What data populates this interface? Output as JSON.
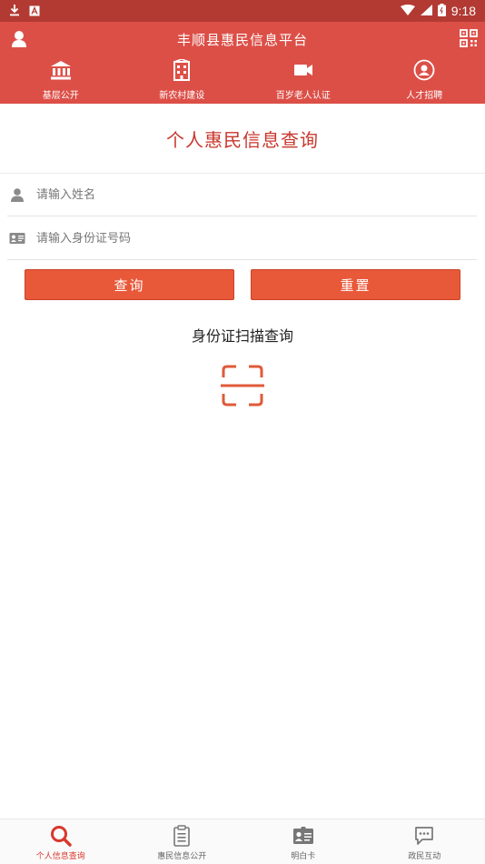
{
  "status_bar": {
    "left_icons": [
      "download-icon",
      "a-square-icon"
    ],
    "right_icons": [
      "wifi-icon",
      "signal-icon",
      "battery-icon"
    ],
    "time": "9:18"
  },
  "header": {
    "title": "丰顺县惠民信息平台",
    "left_icon": "user-icon",
    "right_icon": "qr-code-icon",
    "nav": [
      {
        "label": "基层公开",
        "icon": "bank-icon"
      },
      {
        "label": "新农村建设",
        "icon": "building-icon"
      },
      {
        "label": "百岁老人认证",
        "icon": "video-camera-icon"
      },
      {
        "label": "人才招聘",
        "icon": "person-circle-icon"
      }
    ]
  },
  "main": {
    "title": "个人惠民信息查询",
    "name_placeholder": "请输入姓名",
    "id_placeholder": "请输入身份证号码",
    "query_button": "查询",
    "reset_button": "重置",
    "scan_title": "身份证扫描查询",
    "scan_icon": "scan-icon"
  },
  "tabbar": [
    {
      "label": "个人信息查询",
      "icon": "search-icon",
      "active": true
    },
    {
      "label": "惠民信息公开",
      "icon": "clipboard-icon",
      "active": false
    },
    {
      "label": "明白卡",
      "icon": "id-card-icon",
      "active": false
    },
    {
      "label": "政民互动",
      "icon": "chat-icon",
      "active": false
    }
  ],
  "colors": {
    "status_bar": "#b23a33",
    "header": "#dc4f47",
    "accent": "#e8593a",
    "title_red": "#c8372d",
    "active_tab": "#d9372c"
  }
}
